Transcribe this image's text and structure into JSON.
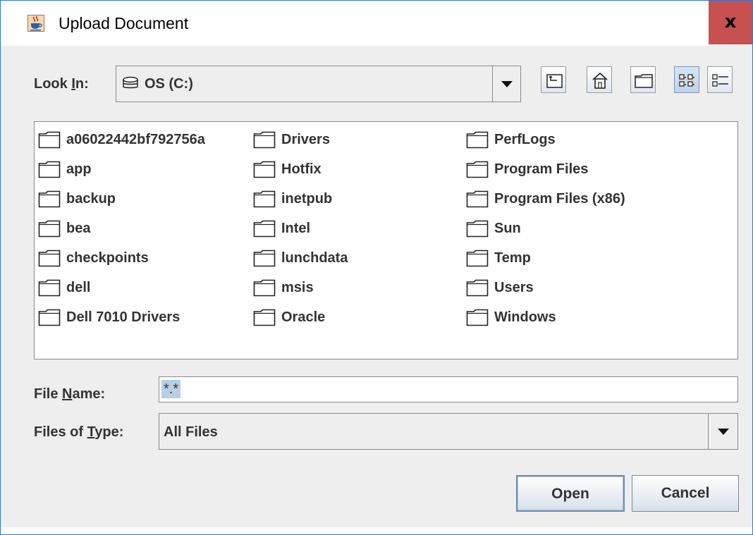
{
  "window": {
    "title": "Upload Document",
    "close_label": "x",
    "icon": "java-cup-icon"
  },
  "look_in": {
    "label": "Look In:",
    "label_mnemonic_pre": "Look ",
    "label_mnemonic_char": "I",
    "label_mnemonic_post": "n:",
    "value": "OS (C:)",
    "icon": "drive-icon"
  },
  "toolbar": {
    "buttons": [
      {
        "name": "up-one-level",
        "icon": "up-folder-icon"
      },
      {
        "name": "home",
        "icon": "home-icon"
      },
      {
        "name": "new-folder",
        "icon": "new-folder-icon"
      },
      {
        "name": "list-view",
        "icon": "list-view-icon",
        "pressed": true
      },
      {
        "name": "details-view",
        "icon": "details-view-icon"
      }
    ]
  },
  "files": {
    "columns": [
      [
        "a06022442bf792756a",
        "app",
        "backup",
        "bea",
        "checkpoints",
        "dell",
        "Dell 7010 Drivers"
      ],
      [
        "Drivers",
        "Hotfix",
        "inetpub",
        "Intel",
        "lunchdata",
        "msis",
        "Oracle"
      ],
      [
        "PerfLogs",
        "Program Files",
        "Program Files (x86)",
        "Sun",
        "Temp",
        "Users",
        "Windows"
      ]
    ],
    "icon": "folder-icon"
  },
  "file_name": {
    "label_pre": "File ",
    "label_mnemonic_char": "N",
    "label_post": "ame:",
    "value": "*.*"
  },
  "file_type": {
    "label_pre": "Files of ",
    "label_mnemonic_char": "T",
    "label_post": "ype:",
    "value": "All Files"
  },
  "buttons": {
    "open": "Open",
    "cancel": "Cancel"
  },
  "colors": {
    "accent_border": "#2b79d8",
    "close_bg": "#c75050",
    "panel_bg": "#eeeeee",
    "text": "#333333"
  }
}
